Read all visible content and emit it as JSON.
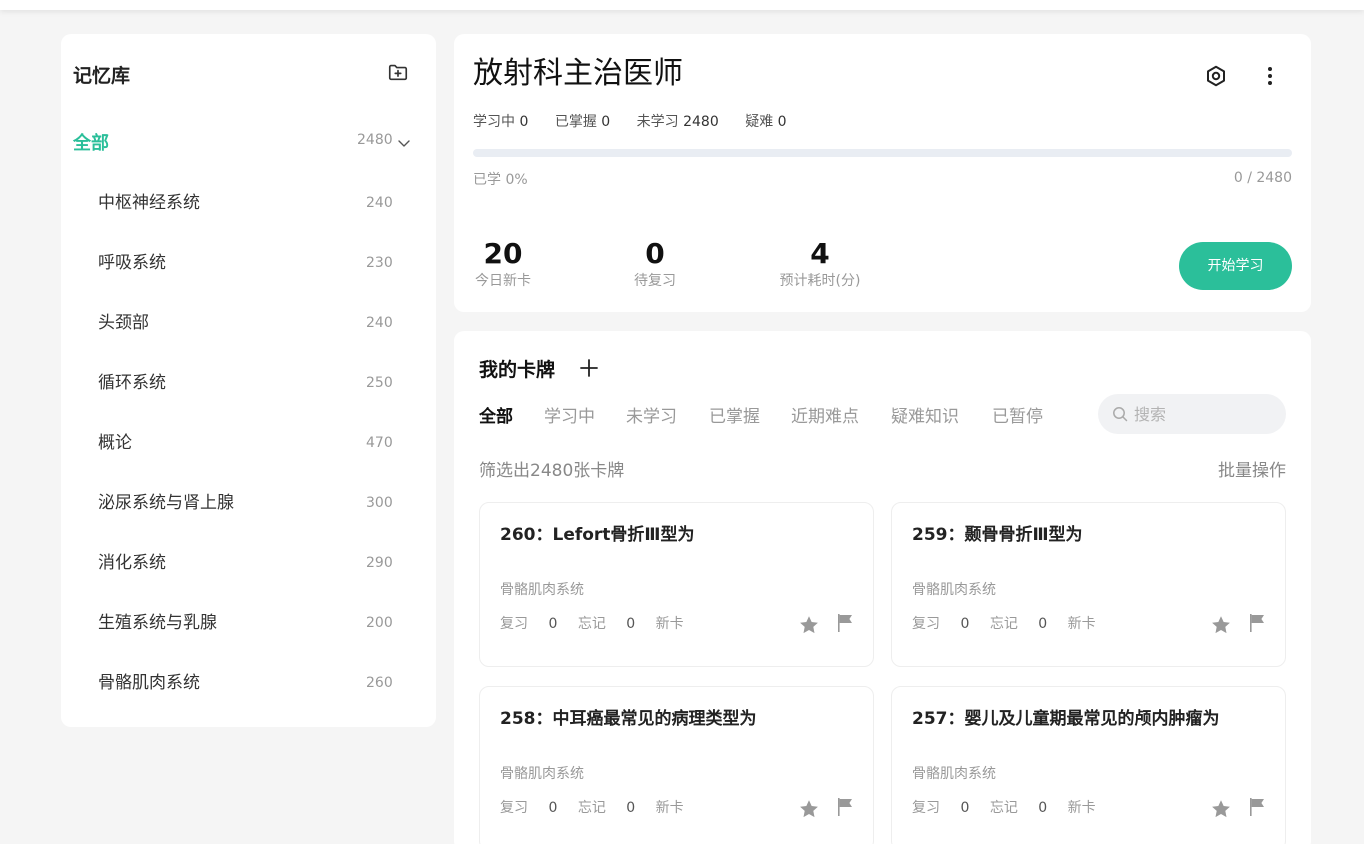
{
  "sidebar": {
    "title": "记忆库",
    "all_label": "全部",
    "all_count": "2480",
    "items": [
      {
        "label": "中枢神经系统",
        "count": "240"
      },
      {
        "label": "呼吸系统",
        "count": "230"
      },
      {
        "label": "头颈部",
        "count": "240"
      },
      {
        "label": "循环系统",
        "count": "250"
      },
      {
        "label": "概论",
        "count": "470"
      },
      {
        "label": "泌尿系统与肾上腺",
        "count": "300"
      },
      {
        "label": "消化系统",
        "count": "290"
      },
      {
        "label": "生殖系统与乳腺",
        "count": "200"
      },
      {
        "label": "骨骼肌肉系统",
        "count": "260"
      }
    ]
  },
  "deck": {
    "title": "放射科主治医师",
    "stats": [
      {
        "label": "学习中",
        "value": "0"
      },
      {
        "label": "已掌握",
        "value": "0"
      },
      {
        "label": "未学习",
        "value": "2480"
      },
      {
        "label": "疑难",
        "value": "0"
      }
    ],
    "progress_fraction": 0,
    "learned_text": "已学 0%",
    "ratio_text": "0 / 2480",
    "metrics": [
      {
        "value": "20",
        "caption": "今日新卡"
      },
      {
        "value": "0",
        "caption": "待复习"
      },
      {
        "value": "4",
        "caption": "预计耗时(分)"
      }
    ],
    "start_label": "开始学习"
  },
  "cards_section": {
    "title": "我的卡牌",
    "tabs": [
      "全部",
      "学习中",
      "未学习",
      "已掌握",
      "近期难点",
      "疑难知识",
      "已暂停"
    ],
    "search_placeholder": "搜索",
    "filter_text": "筛选出2480张卡牌",
    "batch_label": "批量操作",
    "cards": [
      {
        "title": "260：Lefort骨折Ⅲ型为",
        "category": "骨骼肌肉系统",
        "review_label": "复习",
        "review": "0",
        "forget_label": "忘记",
        "forget": "0",
        "status": "新卡"
      },
      {
        "title": "259：颞骨骨折Ⅲ型为",
        "category": "骨骼肌肉系统",
        "review_label": "复习",
        "review": "0",
        "forget_label": "忘记",
        "forget": "0",
        "status": "新卡"
      },
      {
        "title": "258：中耳癌最常见的病理类型为",
        "category": "骨骼肌肉系统",
        "review_label": "复习",
        "review": "0",
        "forget_label": "忘记",
        "forget": "0",
        "status": "新卡"
      },
      {
        "title": "257：婴儿及儿童期最常见的颅内肿瘤为",
        "category": "骨骼肌肉系统",
        "review_label": "复习",
        "review": "0",
        "forget_label": "忘记",
        "forget": "0",
        "status": "新卡"
      }
    ]
  },
  "colors": {
    "accent": "#2bbf9a",
    "background": "#f5f5f5",
    "muted_text": "#999999",
    "icon_gray": "#999999"
  }
}
